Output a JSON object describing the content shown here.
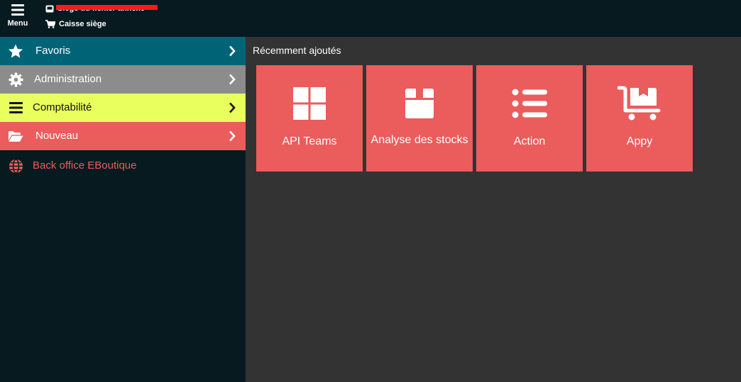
{
  "header": {
    "menu_label": "Menu",
    "redacted_label": "Siège du fichier annexe",
    "register_label": "Caisse siège"
  },
  "sidebar": {
    "items": [
      {
        "label": "Favoris",
        "bg": "#006477",
        "fg": "#ffffff",
        "icon": "star-icon"
      },
      {
        "label": "Administration",
        "bg": "#8c8c8c",
        "fg": "#ffffff",
        "icon": "gear-icon"
      },
      {
        "label": "Comptabilité",
        "bg": "#e9ff5d",
        "fg": "#111111",
        "icon": "list-icon"
      },
      {
        "label": "Nouveau",
        "bg": "#eb5c5c",
        "fg": "#ffffff",
        "icon": "folder-open-icon"
      },
      {
        "label": "Back office EBoutique",
        "bg": "#071a1f",
        "fg": "#eb5c5c",
        "icon": "globe-icon"
      }
    ]
  },
  "main": {
    "section_title": "Récemment ajoutés",
    "tiles": [
      {
        "label": "API Teams",
        "icon": "windows-icon"
      },
      {
        "label": "Analyse des stocks",
        "icon": "box-icon"
      },
      {
        "label": "Action",
        "icon": "list-ul-icon"
      },
      {
        "label": "Appy",
        "icon": "cart-flatbed-icon"
      }
    ]
  },
  "colors": {
    "topbar_bg": "#071a1f",
    "content_bg": "#333333",
    "tile_bg": "#eb5c5c",
    "redaction": "#ff1a0f"
  }
}
